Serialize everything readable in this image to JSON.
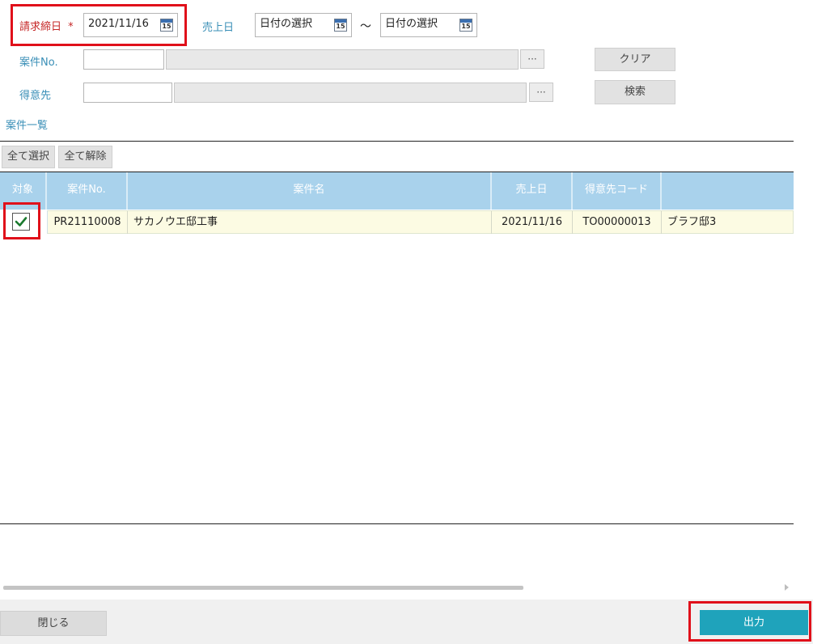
{
  "filters": {
    "billing_cutoff_label": "請求締日",
    "required_mark": "*",
    "billing_cutoff_value": "2021/11/16",
    "calendar_day": "15",
    "sales_date_label": "売上日",
    "sales_date_from": "日付の選択",
    "range_sep": "〜",
    "sales_date_to": "日付の選択",
    "project_no_label": "案件No.",
    "customer_label": "得意先",
    "lookup_label": "···",
    "clear_label": "クリア",
    "search_label": "検索"
  },
  "list": {
    "title": "案件一覧",
    "select_all": "全て選択",
    "deselect_all": "全て解除",
    "columns": [
      "対象",
      "案件No.",
      "案件名",
      "売上日",
      "得意先コード",
      ""
    ],
    "rows": [
      {
        "checked": true,
        "project_no": "PR21110008",
        "project_name": "サカノウエ邸工事",
        "sales_date": "2021/11/16",
        "customer_code": "TO00000013",
        "customer_name": "ブラフ邸3"
      }
    ]
  },
  "footer": {
    "close_label": "閉じる",
    "output_label": "出力"
  },
  "colors": {
    "header_bg": "#a9d2ec",
    "row_bg": "#fcfbe3",
    "accent": "#1fa3bb",
    "highlight": "#e0101a"
  }
}
